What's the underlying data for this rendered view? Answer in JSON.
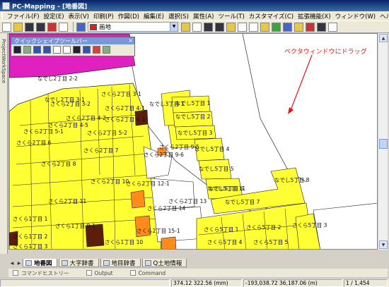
{
  "title": "PC-Mapping - [地番図]",
  "menu": [
    "ファイル(F)",
    "設定(E)",
    "表示(V)",
    "印刷(P)",
    "作図(D)",
    "編集(E)",
    "選択(S)",
    "属性(A)",
    "ツール(T)",
    "カスタマイズ(C)",
    "拡張機能(X)",
    "ウィンドウ(W)",
    "ヘルプ(H)"
  ],
  "toolbar": {
    "layer_selected": "画地"
  },
  "side_panel_label": "ProjectWorkSpace",
  "quick_toolbar": {
    "title": "クイックシェイプツールバー"
  },
  "annotation": {
    "text": "ベクタウィンドウにドラッグ",
    "color": "#ee1111"
  },
  "map": {
    "parcel_colors": {
      "yellow": "#ffff33",
      "orange": "#ff8c1a",
      "brown": "#5a1e0a",
      "magenta": "#e020c0"
    },
    "labels": [
      "なでし2丁目 2-2",
      "なでし3丁目 1",
      "なでし2丁目 3-1",
      "さくら2丁目 3-1",
      "さくら2丁目 3-2",
      "さくら2丁目 4-1",
      "さくら2丁目 4-2",
      "さくら2丁目 4-3",
      "さくら2丁目 4-5",
      "さくら2丁目 5-1",
      "さくら2丁目 5-2",
      "さくら2丁目 6",
      "さくら2丁目 7",
      "さくら2丁目 8",
      "さくら2丁目 9-5",
      "さくら2丁目 9-6",
      "さくら2丁目 10",
      "さくら2丁目 11",
      "さくら2丁目 12-1",
      "さくら2丁目 13",
      "さくら2丁目 14",
      "さくら2丁目 15-1",
      "なでし5丁目 1",
      "なでし5丁目 2",
      "なでし5丁目 3",
      "なでし5丁目 4",
      "なでし5丁目 5",
      "なでし5丁目 6",
      "なでし5丁目 8",
      "なでし5丁目 11",
      "なでし5丁目 7",
      "さくら5丁目 1",
      "さくら5丁目 2",
      "さくら5丁目 3",
      "さくら5丁目 4",
      "さくら5丁目 5",
      "さくら1丁目 1",
      "さくら1丁目 2",
      "さくら1丁目 3",
      "さくら1丁目 9-1",
      "さくら1丁目 10"
    ]
  },
  "tabs": [
    "地番図",
    "大字辞書",
    "地目辞書",
    "Q土地情報"
  ],
  "bottom_tabs": [
    "コマンドヒストリー",
    "Output",
    "Command"
  ],
  "status": [
    "374.12 322.56 (mm)",
    "-193,038.72 36,187.06 (m)",
    "1 / 1,454"
  ]
}
